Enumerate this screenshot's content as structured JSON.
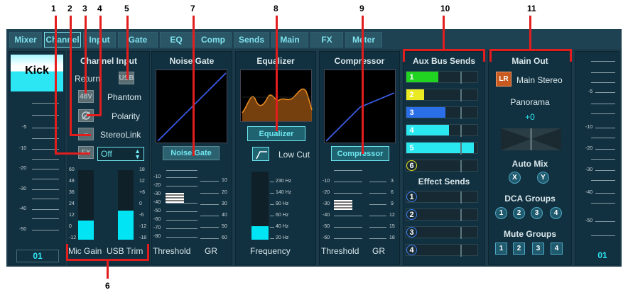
{
  "callouts": [
    "1",
    "2",
    "3",
    "4",
    "5",
    "6",
    "7",
    "8",
    "9",
    "10",
    "11"
  ],
  "tabs": [
    "Mixer",
    "Channel",
    "Input",
    "Gate",
    "EQ",
    "Comp",
    "Sends",
    "Main",
    "FX",
    "Meter"
  ],
  "channel_name": "Kick",
  "left_channel": "01",
  "right_channel": "01",
  "fader_scale": [
    "-5",
    "-10",
    "-20",
    "-30",
    "-40",
    "-50"
  ],
  "right_scale": [
    "-5",
    "-10",
    "-20",
    "-30",
    "-40",
    "-50"
  ],
  "channel_input": {
    "title": "Channel Input",
    "return_label": "Return",
    "usb_label": "USB",
    "phantom_btn": "48V",
    "phantom_label": "Phantom",
    "polarity_label": "Polarity",
    "stereolink_label": "StereoLink",
    "fx_label": "FX",
    "fx_value": "Off",
    "mic_scale": [
      "60",
      "48",
      "36",
      "24",
      "12",
      "0",
      "-12"
    ],
    "usb_scale": [
      "18",
      "12",
      "+6",
      "0",
      "-6",
      "-12",
      "-18"
    ],
    "mic_gain_label": "Mic Gain",
    "usb_trim_label": "USB Trim",
    "mic_gain_level": 0.28,
    "usb_trim_level": 0.42
  },
  "noise_gate": {
    "title": "Noise Gate",
    "button": "Noise Gate",
    "left_scale": [
      "-10",
      "-20",
      "-30",
      "-40",
      "-50",
      "-60",
      "-70",
      "-80"
    ],
    "right_scale": [
      "10",
      "20",
      "30",
      "40",
      "50",
      "60"
    ],
    "threshold_label": "Threshold",
    "gr_label": "GR"
  },
  "equalizer": {
    "title": "Equalizer",
    "button": "Equalizer",
    "lowcut_label": "Low Cut",
    "freq_scale": [
      "230 Hz",
      "140 Hz",
      "90 Hz",
      "60 Hz",
      "40 Hz",
      "20 Hz"
    ],
    "frequency_label": "Frequency",
    "level": 0.2
  },
  "compressor": {
    "title": "Compressor",
    "button": "Compressor",
    "left_scale": [
      "-10",
      "-20",
      "-30",
      "-40",
      "-50",
      "-60"
    ],
    "right_scale": [
      "3",
      "6",
      "9",
      "12",
      "15",
      "18"
    ],
    "threshold_label": "Threshold",
    "gr_label": "GR"
  },
  "aux": {
    "title": "Aux Bus Sends",
    "sends": [
      {
        "n": "1",
        "color": "#22d422",
        "level": 0.45
      },
      {
        "n": "2",
        "color": "#eaea22",
        "level": 0.25
      },
      {
        "n": "3",
        "color": "#2a6ee8",
        "level": 0.55
      },
      {
        "n": "4",
        "color": "#2ae8f0",
        "level": 0.6
      },
      {
        "n": "5",
        "color": "#2ae8f0",
        "level": 0.95
      },
      {
        "n": "6",
        "color": "#eaea22",
        "level": 0.0
      }
    ],
    "effect_title": "Effect Sends",
    "effects": [
      "1",
      "2",
      "3",
      "4"
    ]
  },
  "main": {
    "title": "Main Out",
    "lr": "LR",
    "stereo": "Main Stereo",
    "panorama": "Panorama",
    "pan_value": "+0",
    "automix": "Auto Mix",
    "automix_btns": [
      "X",
      "Y"
    ],
    "dca": "DCA Groups",
    "dca_btns": [
      "1",
      "2",
      "3",
      "4"
    ],
    "mute": "Mute Groups",
    "mute_btns": [
      "1",
      "2",
      "3",
      "4"
    ]
  }
}
